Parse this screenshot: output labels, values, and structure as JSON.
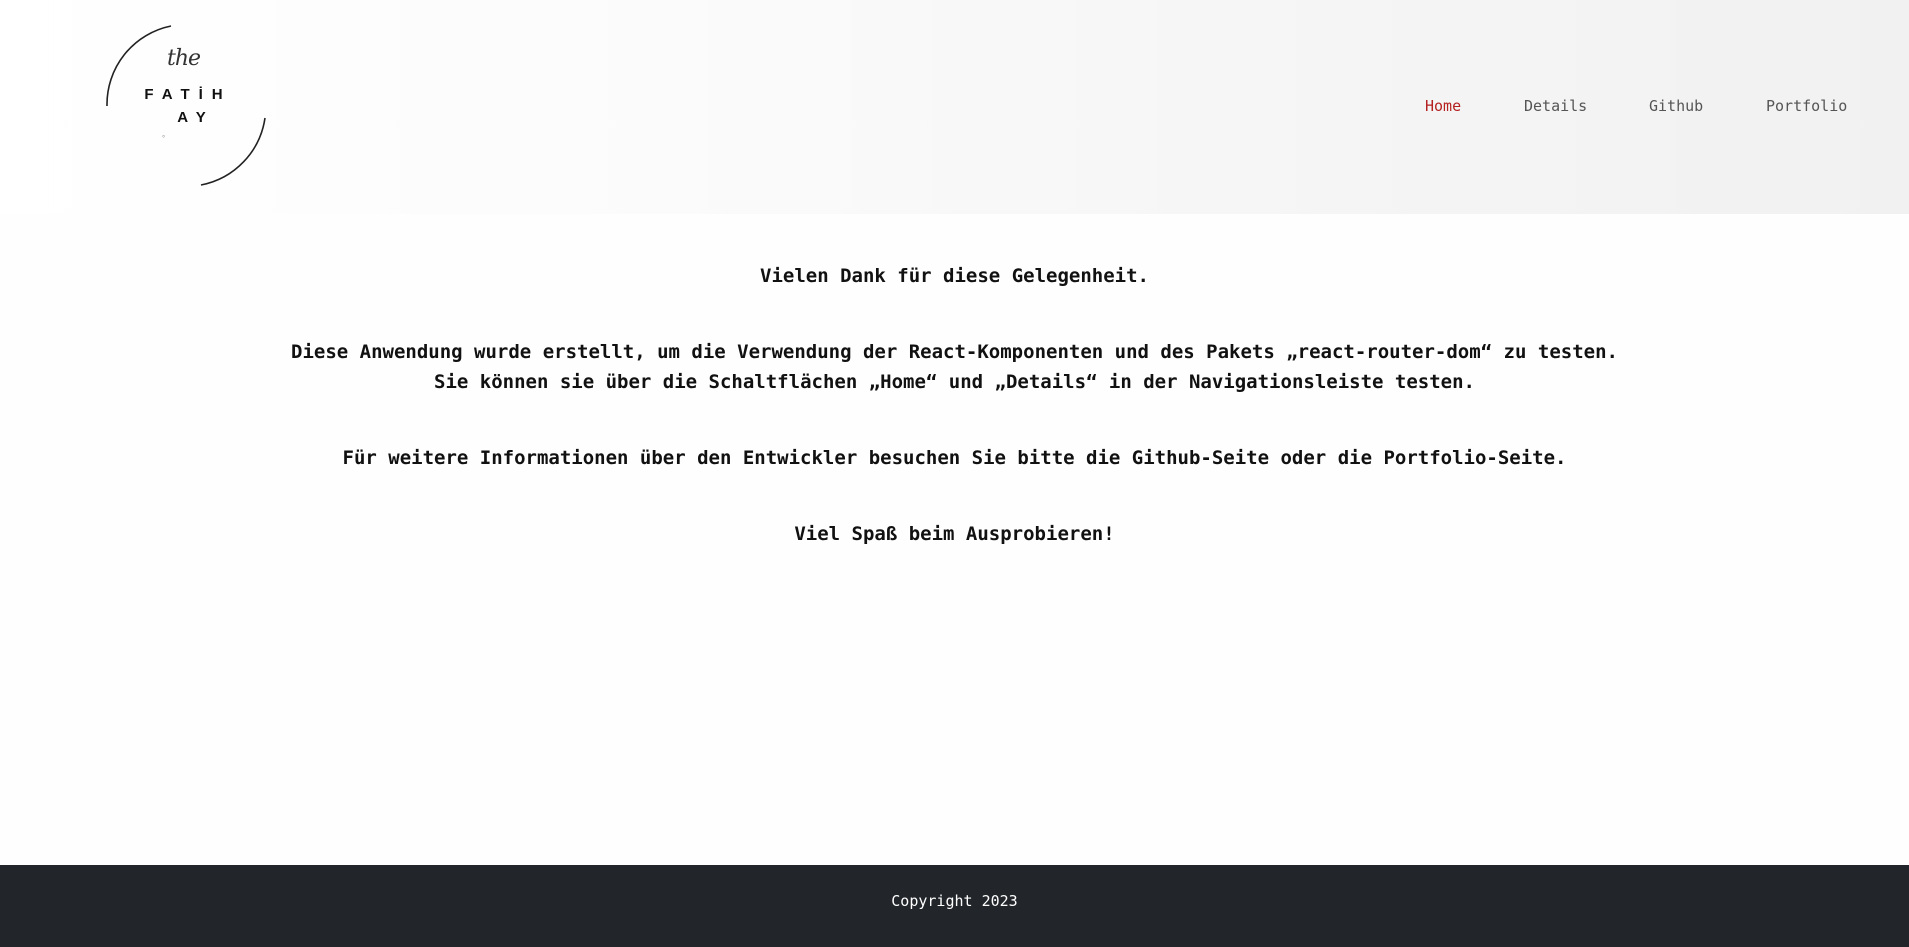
{
  "header": {
    "logo": {
      "the": "the",
      "line1": "FATİH",
      "line2": "AY",
      "mark": "°"
    },
    "nav": [
      {
        "label": "Home",
        "active": true
      },
      {
        "label": "Details",
        "active": false
      },
      {
        "label": "Github",
        "active": false
      },
      {
        "label": "Portfolio",
        "active": false
      }
    ]
  },
  "main": {
    "paragraphs": [
      "Vielen Dank für diese Gelegenheit.",
      "Diese Anwendung wurde erstellt, um die Verwendung der React-Komponenten und des Pakets „react-router-dom“ zu testen.",
      "Sie können sie über die Schaltflächen „Home“ und „Details“ in der Navigationsleiste testen.",
      "Für weitere Informationen über den Entwickler besuchen Sie bitte die Github-Seite oder die Portfolio-Seite.",
      "Viel Spaß beim Ausprobieren!"
    ]
  },
  "footer": {
    "copyright": "Copyright 2023"
  },
  "colors": {
    "nav_active": "#b52121",
    "nav_default": "#555555",
    "footer_bg": "#22252a",
    "text": "#111111"
  }
}
